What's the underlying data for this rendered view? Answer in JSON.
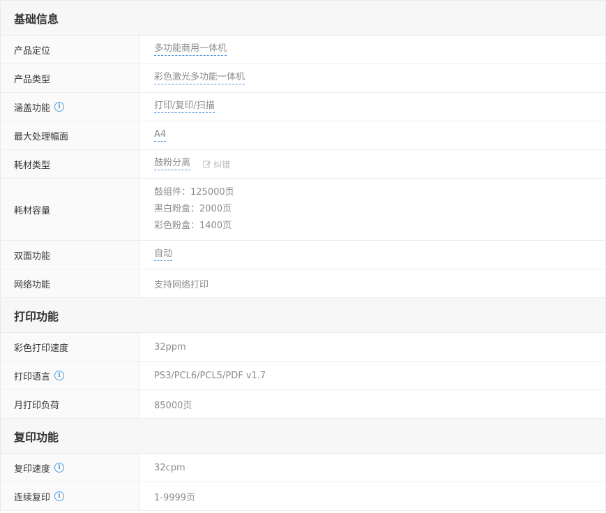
{
  "sections": {
    "basic": {
      "title": "基础信息",
      "rows": [
        {
          "label": "产品定位",
          "value": "多功能商用一体机"
        },
        {
          "label": "产品类型",
          "value": "彩色激光多功能一体机"
        },
        {
          "label": "涵盖功能",
          "value": "打印/复印/扫描"
        },
        {
          "label": "最大处理幅面",
          "value": "A4"
        },
        {
          "label": "耗材类型",
          "value": "鼓粉分离",
          "extra": "纠错"
        },
        {
          "label": "耗材容量",
          "lines": [
            "鼓组件：125000页",
            "黑白粉盒：2000页",
            "彩色粉盒：1400页"
          ]
        },
        {
          "label": "双面功能",
          "value": "自动"
        },
        {
          "label": "网络功能",
          "value": "支持网络打印"
        }
      ]
    },
    "print": {
      "title": "打印功能",
      "rows": [
        {
          "label": "彩色打印速度",
          "value": "32ppm"
        },
        {
          "label": "打印语言",
          "value": "PS3/PCL6/PCL5/PDF v1.7"
        },
        {
          "label": "月打印负荷",
          "value": "85000页"
        }
      ]
    },
    "copy": {
      "title": "复印功能",
      "rows": [
        {
          "label": "复印速度",
          "value": "32cpm"
        },
        {
          "label": "连续复印",
          "value": "1-9999页"
        }
      ]
    }
  },
  "icons": {
    "info": "info-circle-icon",
    "edit": "pencil-icon"
  },
  "colors": {
    "link_underline": "#4a90d9",
    "info_icon": "#4a9ee8"
  }
}
